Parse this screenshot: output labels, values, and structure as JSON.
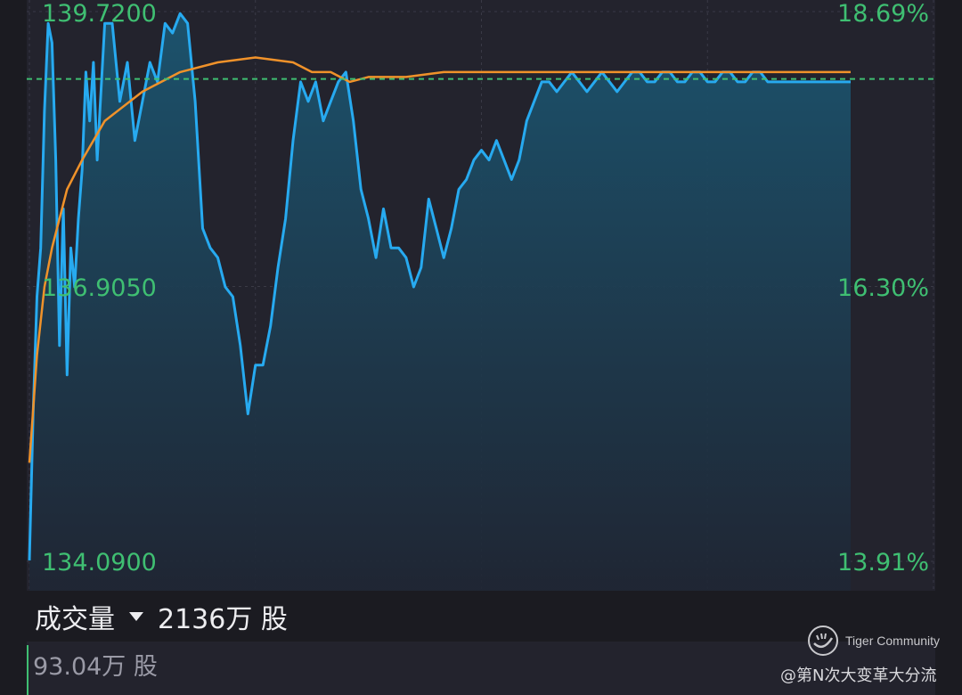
{
  "chart_data": {
    "type": "line",
    "y_axis_left": [
      "139.7200",
      "136.9050",
      "134.0900"
    ],
    "y_axis_right": [
      "18.69%",
      "16.30%",
      "13.91%"
    ],
    "ylim": [
      134.09,
      139.72
    ],
    "x_range": [
      0,
      240
    ],
    "reference_price": 139.03,
    "grid": true,
    "series": [
      {
        "color": "#27aaf0",
        "style": "area",
        "x": [
          0,
          1,
          2,
          3,
          4,
          5,
          6,
          7,
          8,
          9,
          10,
          11,
          12,
          13,
          14,
          15,
          16,
          17,
          18,
          20,
          22,
          24,
          26,
          28,
          30,
          32,
          34,
          36,
          38,
          40,
          42,
          44,
          46,
          48,
          50,
          52,
          54,
          56,
          58,
          60,
          62,
          64,
          66,
          68,
          70,
          72,
          74,
          76,
          78,
          80,
          82,
          84,
          86,
          88,
          90,
          92,
          94,
          96,
          98,
          100,
          102,
          104,
          106,
          108,
          110,
          112,
          114,
          116,
          118,
          120,
          122,
          124,
          126,
          128,
          130,
          132,
          134,
          136,
          138,
          140,
          142,
          144,
          146,
          148,
          150,
          152,
          154,
          156,
          158,
          160,
          162,
          164,
          166,
          168,
          170,
          172,
          174,
          176,
          178,
          180,
          182,
          184,
          186,
          188,
          190,
          192,
          194,
          196,
          198,
          200,
          202,
          204,
          206,
          208,
          210,
          212,
          214,
          216,
          218
        ],
        "values": [
          134.1,
          135.6,
          136.8,
          137.3,
          138.7,
          139.6,
          139.4,
          138.2,
          136.3,
          137.7,
          136.0,
          137.3,
          136.9,
          137.6,
          138.1,
          139.1,
          138.6,
          139.2,
          138.2,
          139.6,
          139.6,
          138.8,
          139.2,
          138.4,
          138.8,
          139.2,
          139.0,
          139.6,
          139.5,
          139.7,
          139.6,
          138.8,
          137.5,
          137.3,
          137.2,
          136.9,
          136.8,
          136.3,
          135.6,
          136.1,
          136.1,
          136.5,
          137.1,
          137.6,
          138.4,
          139.0,
          138.8,
          139.0,
          138.6,
          138.8,
          139.0,
          139.1,
          138.6,
          137.9,
          137.6,
          137.2,
          137.7,
          137.3,
          137.3,
          137.2,
          136.9,
          137.1,
          137.8,
          137.5,
          137.2,
          137.5,
          137.9,
          138.0,
          138.2,
          138.3,
          138.2,
          138.4,
          138.2,
          138.0,
          138.2,
          138.6,
          138.8,
          139.0,
          139.0,
          138.9,
          139.0,
          139.1,
          139.0,
          138.9,
          139.0,
          139.1,
          139.0,
          138.9,
          139.0,
          139.1,
          139.1,
          139.0,
          139.0,
          139.1,
          139.1,
          139.0,
          139.0,
          139.1,
          139.1,
          139.0,
          139.0,
          139.1,
          139.1,
          139.0,
          139.0,
          139.1,
          139.1,
          139.0,
          139.0,
          139.0,
          139.0,
          139.0,
          139.0,
          139.0,
          139.0,
          139.0,
          139.0,
          139.0,
          139.0
        ]
      },
      {
        "color": "#f0922a",
        "style": "line",
        "x": [
          0,
          2,
          4,
          6,
          8,
          10,
          14,
          20,
          30,
          40,
          50,
          60,
          70,
          75,
          80,
          85,
          90,
          100,
          110,
          120,
          140,
          160,
          180,
          200,
          218
        ],
        "values": [
          135.1,
          136.2,
          136.9,
          137.3,
          137.6,
          137.9,
          138.2,
          138.6,
          138.9,
          139.1,
          139.2,
          139.25,
          139.2,
          139.1,
          139.1,
          139.0,
          139.05,
          139.05,
          139.1,
          139.1,
          139.1,
          139.1,
          139.1,
          139.1,
          139.1
        ]
      }
    ]
  },
  "volume": {
    "label": "成交量",
    "total": "2136万 股",
    "axis_max": "93.04万 股"
  },
  "watermark": {
    "brand": "Tiger Community",
    "author": "@第N次大变革大分流"
  }
}
